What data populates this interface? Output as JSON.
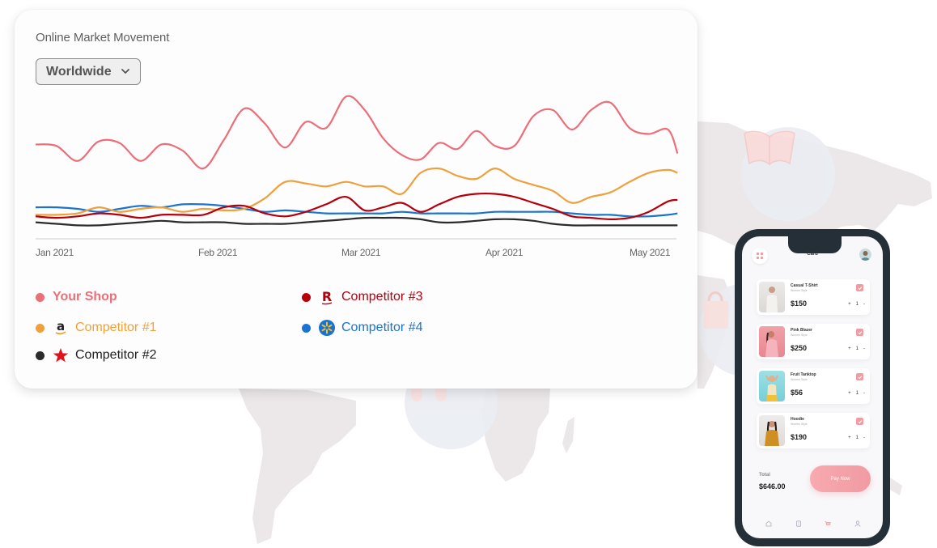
{
  "card": {
    "title": "Online Market Movement",
    "region_select": {
      "value": "Worldwide"
    }
  },
  "chart_data": {
    "type": "line",
    "title": "Online Market Movement",
    "xlabel": "",
    "ylabel": "",
    "grid": false,
    "legend_position": "bottom",
    "x_unit": "day-of-year 2021",
    "x": [
      1,
      5,
      9,
      13,
      17,
      21,
      25,
      29,
      33,
      37,
      41,
      45,
      49,
      53,
      57,
      61,
      65,
      69,
      73,
      77,
      81,
      85,
      89,
      93,
      97,
      101,
      105,
      109,
      113,
      117,
      121,
      125,
      129,
      131
    ],
    "x_ticks": [
      {
        "day": 1,
        "label": "Jan 2021"
      },
      {
        "day": 32,
        "label": "Feb 2021"
      },
      {
        "day": 60,
        "label": "Mar 2021"
      },
      {
        "day": 91,
        "label": "Apr 2021"
      },
      {
        "day": 121,
        "label": "May 2021"
      }
    ],
    "ylim": [
      0,
      100
    ],
    "series": [
      {
        "name": "Your Shop",
        "color": "#ec6e78",
        "values": [
          63,
          62,
          52,
          65,
          64,
          52,
          63,
          59,
          47,
          66,
          87,
          77,
          61,
          78,
          74,
          95,
          86,
          67,
          56,
          53,
          64,
          60,
          72,
          62,
          62,
          82,
          86,
          73,
          86,
          91,
          74,
          70,
          73,
          57
        ]
      },
      {
        "name": "Competitor #1",
        "color": "#efa03a",
        "values": [
          16,
          16,
          17,
          21,
          18,
          20,
          21,
          18,
          20,
          19,
          20,
          27,
          38,
          37,
          35,
          38,
          35,
          35,
          30,
          44,
          47,
          42,
          40,
          47,
          40,
          36,
          32,
          24,
          28,
          31,
          38,
          44,
          46,
          44
        ]
      },
      {
        "name": "Competitor #2",
        "color": "#2b2b2b",
        "values": [
          11,
          10,
          9,
          9,
          10,
          11,
          12,
          11,
          11,
          11,
          10,
          10,
          10,
          11,
          12,
          13,
          14,
          14,
          14,
          13,
          11,
          11,
          12,
          13,
          13,
          12,
          10,
          9,
          9,
          9,
          9,
          9,
          9,
          9
        ]
      },
      {
        "name": "Competitor #3",
        "color": "#b5000c",
        "values": [
          15,
          14,
          15,
          17,
          16,
          14,
          16,
          16,
          16,
          21,
          22,
          17,
          15,
          18,
          23,
          28,
          19,
          21,
          24,
          18,
          23,
          28,
          30,
          30,
          28,
          24,
          20,
          15,
          14,
          13,
          14,
          18,
          25,
          26
        ]
      },
      {
        "name": "Competitor #4",
        "color": "#1a73d0",
        "values": [
          21,
          21,
          20,
          18,
          20,
          22,
          21,
          23,
          23,
          22,
          20,
          18,
          19,
          18,
          17,
          17,
          17,
          17,
          18,
          17,
          17,
          17,
          17,
          18,
          18,
          18,
          18,
          17,
          16,
          16,
          15,
          15,
          16,
          17
        ]
      }
    ]
  },
  "legend": [
    {
      "label": "Your Shop",
      "color": "#ec6e78",
      "logo": "none",
      "bold": true
    },
    {
      "label": "Competitor #1",
      "color": "#efa03a",
      "logo": "amazon-logo-icon",
      "text_color": "#efa03a"
    },
    {
      "label": "Competitor #2",
      "color": "#2b2b2b",
      "logo": "star-icon",
      "text_color": "#1e1e1e"
    },
    {
      "label": "Competitor #3",
      "color": "#b5000c",
      "logo": "rakuten-logo-icon",
      "text_color": "#b5000c"
    },
    {
      "label": "Competitor #4",
      "color": "#1a73d0",
      "logo": "walmart-spark-icon",
      "text_color": "#1a73d0"
    }
  ],
  "phone": {
    "title": "Card",
    "items": [
      {
        "name": "Casual T-Shirt",
        "subtitle": "Women Style",
        "price": "$150",
        "qty": "1",
        "plus": "+",
        "minus": "-"
      },
      {
        "name": "Pink Blazer",
        "subtitle": "Women Style",
        "price": "$250",
        "qty": "1",
        "plus": "+",
        "minus": "-"
      },
      {
        "name": "Fruit Tanktop",
        "subtitle": "Women Style",
        "price": "$56",
        "qty": "1",
        "plus": "+",
        "minus": "-"
      },
      {
        "name": "Hoodie",
        "subtitle": "Women Style",
        "price": "$190",
        "qty": "1",
        "plus": "+",
        "minus": "-"
      }
    ],
    "total_label": "Total",
    "total_value": "$646.00",
    "pay_button": "Pay Now",
    "tabs": [
      "home-icon",
      "orders-icon",
      "cart-icon",
      "profile-icon"
    ],
    "active_tab": "cart-icon",
    "accent": "#f29ba3"
  },
  "background": {
    "decorations": [
      "book-icon",
      "headphones-icon",
      "shopping-bag-icon"
    ]
  }
}
